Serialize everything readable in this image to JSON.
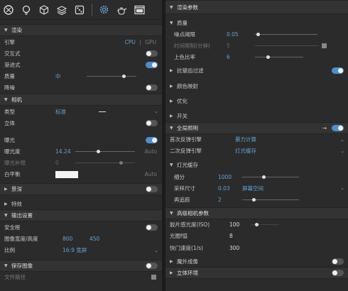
{
  "toolbar": {
    "icons": [
      "render-icon",
      "bulb-icon",
      "cube-icon",
      "layers-icon",
      "dice-icon",
      "gear-icon",
      "teapot-icon",
      "window-icon"
    ]
  },
  "left": {
    "render": {
      "title": "渲染",
      "engine_label": "引擎",
      "engine_cpu": "CPU",
      "engine_sep": "|",
      "engine_gpu": "GPU",
      "interactive_label": "交互式",
      "progressive_label": "渐进式",
      "quality_label": "质量",
      "quality_value": "中",
      "denoise_label": "降噪"
    },
    "camera": {
      "title": "相机",
      "type_label": "类型",
      "type_value": "标准",
      "stereo_label": "立体"
    },
    "exposure": {
      "label": "曝光",
      "ev_label": "曝光度",
      "ev_value": "14.24",
      "ev_auto": "Auto",
      "comp_label": "曝光补偿",
      "comp_value": "0",
      "wb_label": "白平衡",
      "wb_auto": "Auto"
    },
    "dof_label": "景深",
    "effects_label": "特效",
    "output": {
      "title": "输出设置",
      "safe_label": "安全框",
      "size_label": "图像宽度/高度",
      "width": "800",
      "height": "450",
      "ratio_label": "比例",
      "ratio_value": "16:9 宽屏"
    },
    "save": {
      "label": "保存图像",
      "path_label": "文件路径"
    }
  },
  "right": {
    "render_params": {
      "title": "渲染参数"
    },
    "quality": {
      "title": "质量",
      "noise_label": "噪点阈限",
      "noise_value": "0.05",
      "time_label": "时间限制(分钟)",
      "time_value": "5",
      "color_label": "上色比率",
      "color_value": "6"
    },
    "aa_label": "抗锯齿过滤",
    "color_map_label": "颜色映射",
    "optimize_label": "优化",
    "switch_label": "开关",
    "gi": {
      "title": "全局照明",
      "primary_label": "首次反弹引擎",
      "primary_value": "暴力计算",
      "secondary_label": "二次反弹引擎",
      "secondary_value": "灯光缓存"
    },
    "light_cache": {
      "title": "灯光缓存",
      "subdiv_label": "细分",
      "subdiv_value": "1000",
      "sample_label": "采样尺寸",
      "sample_value": "0.03",
      "sample_space": "屏幕空间",
      "retrace_label": "再追踪",
      "retrace_value": "2"
    },
    "camera_adv": {
      "title": "高级相机参数",
      "iso_label": "胶片感光度(ISO)",
      "iso_value": "100",
      "aperture_label": "光圈f值",
      "aperture_value": "8",
      "shutter_label": "快门速度(1/s)",
      "shutter_value": "300"
    },
    "ir_label": "魔外成像",
    "env_label": "立体环境"
  }
}
